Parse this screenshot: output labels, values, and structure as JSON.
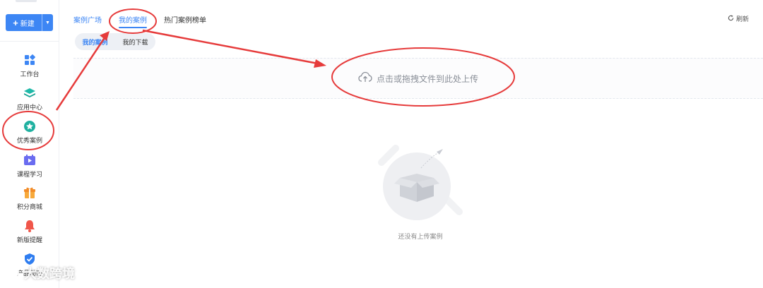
{
  "sidebar": {
    "new_button": {
      "label": "新建"
    },
    "items": [
      {
        "label": "工作台",
        "icon": "dashboard-icon"
      },
      {
        "label": "应用中心",
        "icon": "layers-icon"
      },
      {
        "label": "优秀案例",
        "icon": "star-icon"
      },
      {
        "label": "课程学习",
        "icon": "video-icon"
      },
      {
        "label": "积分商城",
        "icon": "gift-icon"
      },
      {
        "label": "新版提醒",
        "icon": "bell-icon"
      },
      {
        "label": "产品动态",
        "icon": "shield-icon"
      }
    ]
  },
  "header": {
    "tabs": [
      {
        "label": "案例广场"
      },
      {
        "label": "我的案例"
      },
      {
        "label": "热门案例榜单"
      }
    ],
    "refresh_label": "刷新"
  },
  "subtabs": [
    {
      "label": "我的案例"
    },
    {
      "label": "我的下载"
    }
  ],
  "upload": {
    "label": "点击或拖拽文件到此处上传"
  },
  "empty_state": {
    "text": "还没有上传案例"
  },
  "watermark": {
    "text": "大数跨境"
  },
  "colors": {
    "accent": "#3d86f4",
    "annotation": "#e63b3b"
  }
}
